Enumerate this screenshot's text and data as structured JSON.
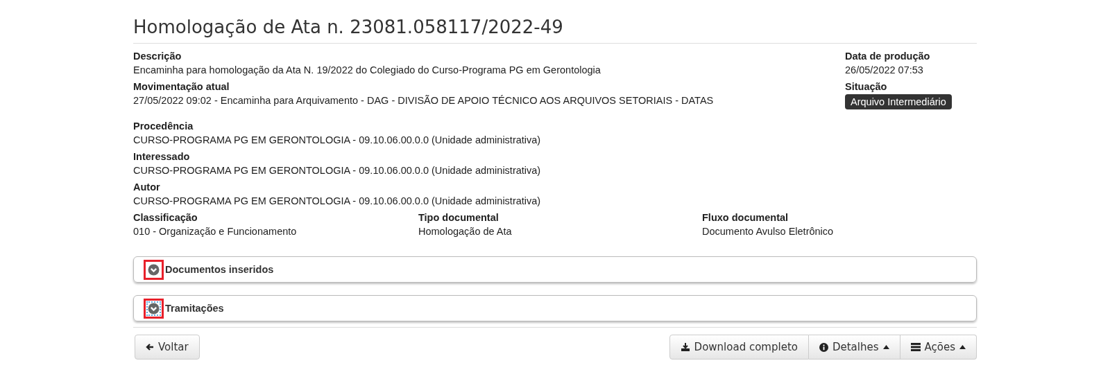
{
  "title": "Homologação de Ata n. 23081.058117/2022-49",
  "main_fields": [
    {
      "label": "Descrição",
      "value": "Encaminha para homologação da Ata N. 19/2022 do Colegiado do Curso-Programa PG em Gerontologia"
    },
    {
      "label": "Movimentação atual",
      "value": "27/05/2022 09:02 - Encaminha para Arquivamento - DAG - DIVISÃO DE APOIO TÉCNICO AOS ARQUIVOS SETORIAIS - DATAS"
    }
  ],
  "side_fields": [
    {
      "label": "Data de produção",
      "value": "26/05/2022 07:53",
      "kind": "text"
    },
    {
      "label": "Situação",
      "value": "Arquivo Intermediário",
      "kind": "badge"
    }
  ],
  "more_fields": [
    {
      "label": "Procedência",
      "value": "CURSO-PROGRAMA PG EM GERONTOLOGIA - 09.10.06.00.0.0 (Unidade administrativa)"
    },
    {
      "label": "Interessado",
      "value": "CURSO-PROGRAMA PG EM GERONTOLOGIA - 09.10.06.00.0.0 (Unidade administrativa)"
    },
    {
      "label": "Autor",
      "value": "CURSO-PROGRAMA PG EM GERONTOLOGIA - 09.10.06.00.0.0 (Unidade administrativa)"
    }
  ],
  "columns": [
    {
      "label": "Classificação",
      "value": "010 - Organização e Funcionamento"
    },
    {
      "label": "Tipo documental",
      "value": "Homologação de Ata"
    },
    {
      "label": "Fluxo documental",
      "value": "Documento Avulso Eletrônico"
    }
  ],
  "panels": [
    {
      "title": "Documentos inseridos",
      "highlighted": true,
      "focused": false
    },
    {
      "title": "Tramitações",
      "highlighted": true,
      "focused": true
    }
  ],
  "back_button": "Voltar",
  "actions": [
    {
      "label": "Download completo",
      "kind": "download",
      "caret": false
    },
    {
      "label": "Detalhes",
      "kind": "info",
      "caret": true
    },
    {
      "label": "Ações",
      "kind": "menu",
      "caret": true
    }
  ]
}
